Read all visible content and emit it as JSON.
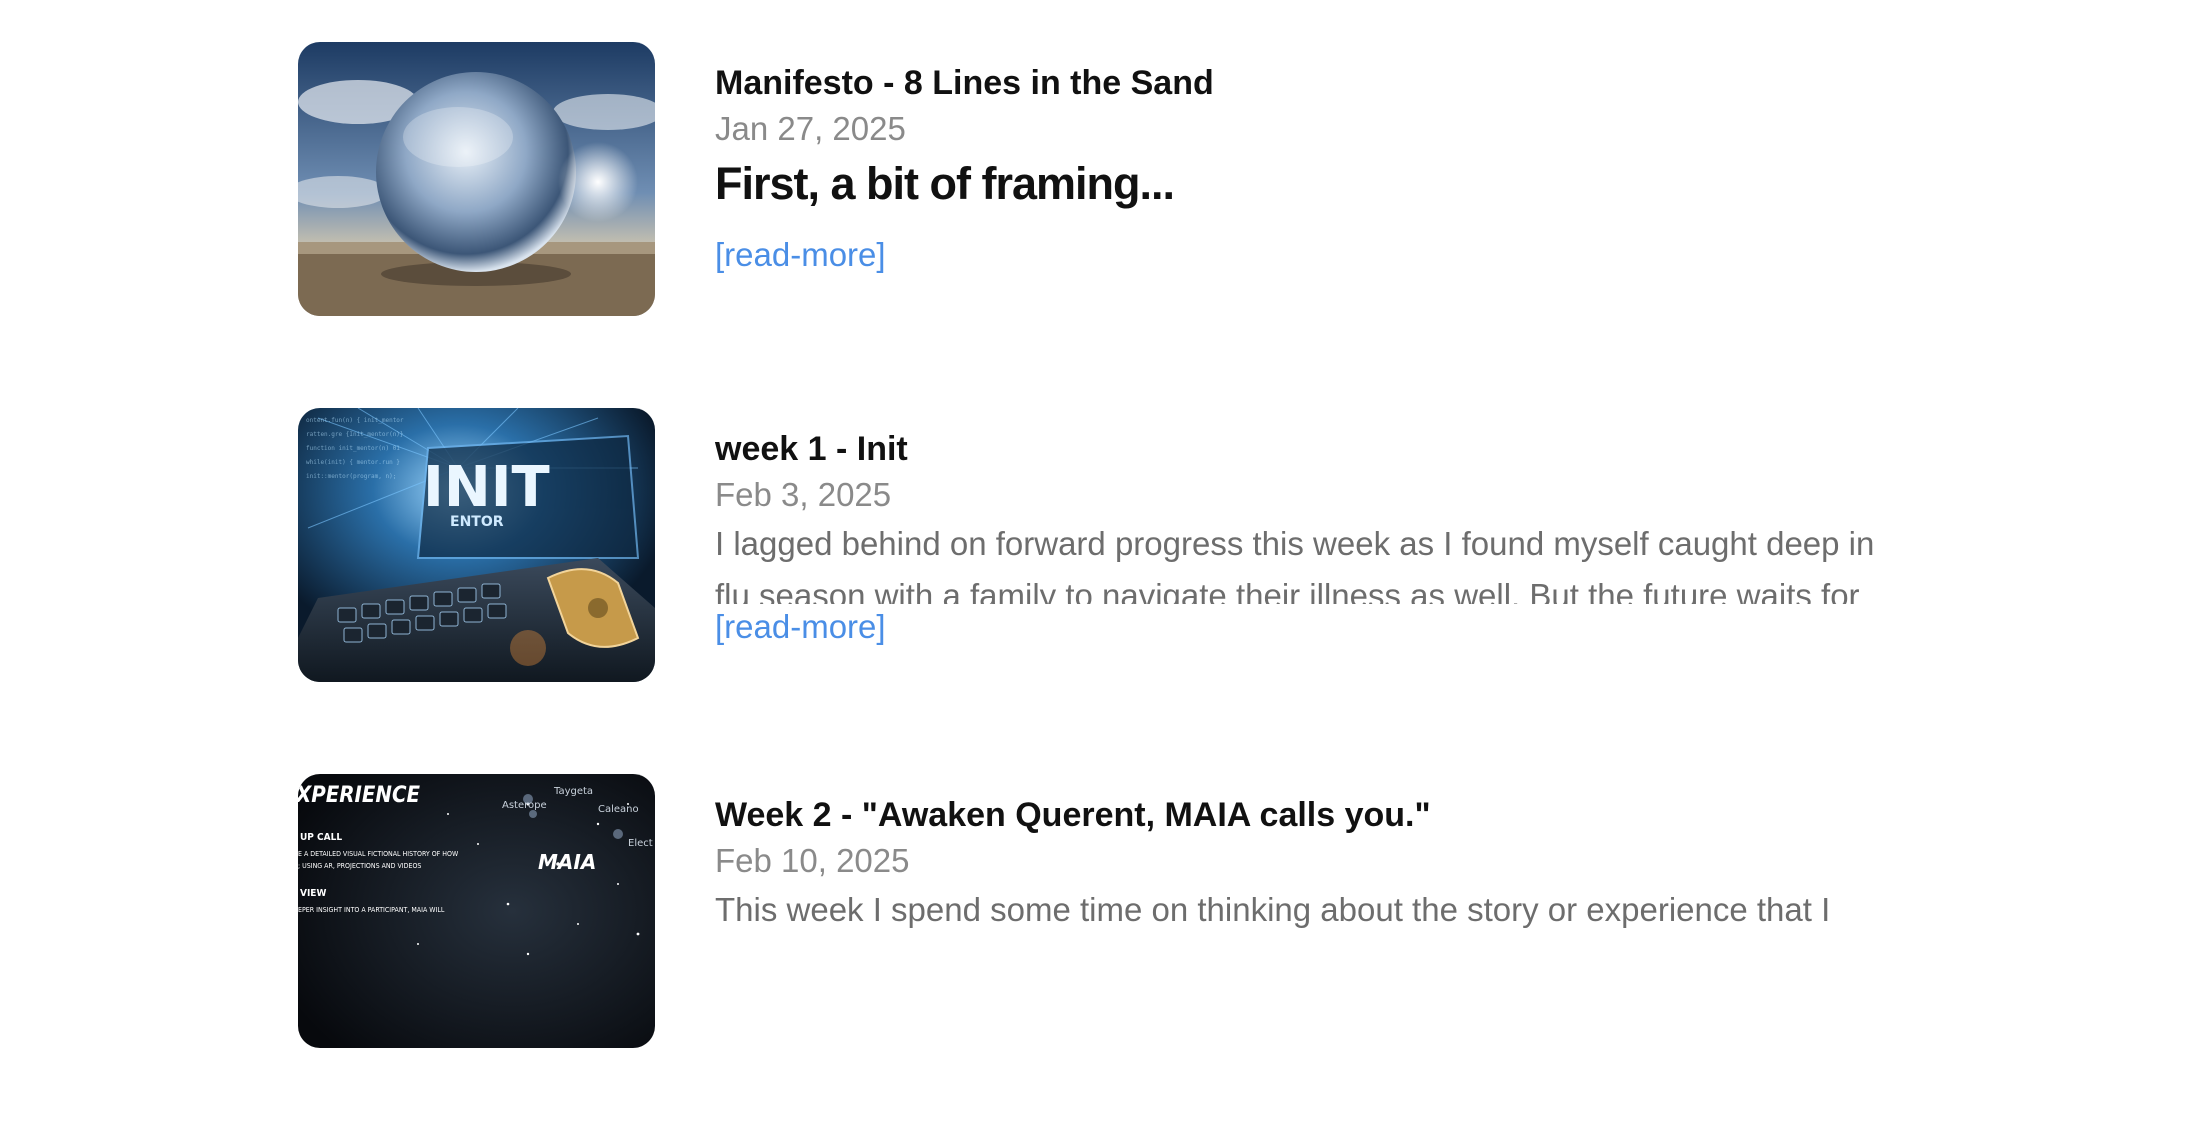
{
  "posts": [
    {
      "title": "Manifesto - 8 Lines in the Sand",
      "date": "Jan 27, 2025",
      "lead": "First, a bit of framing...",
      "read_more": "[read-more]",
      "thumbnail": "crystal-sphere-desert-image"
    },
    {
      "title": "week 1 - Init",
      "date": "Feb 3, 2025",
      "excerpt": "I lagged behind on forward progress this week as I found myself caught deep in flu season with a family to navigate their illness as well. But the future waits for",
      "read_more": "[read-more]",
      "thumbnail": "robot-keyboard-init-image",
      "thumb_text": {
        "big": "INIT",
        "small": "ENTOR"
      }
    },
    {
      "title": "Week 2 - \"Awaken Querent, MAIA calls you.\"",
      "date": "Feb 10, 2025",
      "excerpt": "This week I spend some time on thinking about the story or experience that I",
      "thumbnail": "maia-star-map-image",
      "thumb_text": {
        "heading": "XPERIENCE",
        "sub1": "UP CALL",
        "sub2": "E A DETAILED VISUAL FICTIONAL HISTORY OF HOW",
        "sub3": "; USING AR, PROJECTIONS AND VIDEOS",
        "sub4": "VIEW",
        "sub5": "EPER INSIGHT INTO A PARTICIPANT, MAIA WILL",
        "maia": "MAIA",
        "stars": [
          "Taygeta",
          "Asterope",
          "Caleano",
          "Elect"
        ]
      }
    }
  ],
  "colors": {
    "title": "#111111",
    "date": "#8a8a8a",
    "excerpt": "#6d6d6d",
    "link": "#4a8ee6"
  }
}
